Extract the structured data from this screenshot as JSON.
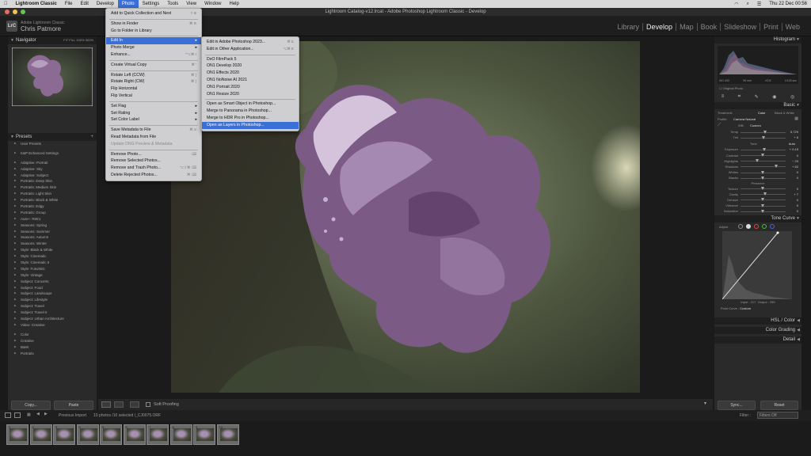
{
  "menubar": {
    "apple": "",
    "app": "Lightroom Classic",
    "items": [
      "File",
      "Edit",
      "Develop",
      "Photo",
      "Settings",
      "Tools",
      "View",
      "Window",
      "Help"
    ],
    "active": "Photo",
    "clock": "Thu 22 Dec  00:56"
  },
  "window": {
    "title": "Lightroom Catalog-v12.lrcat - Adobe Photoshop Lightroom Classic - Develop"
  },
  "identity": {
    "logo": "LrC",
    "line1": "Adobe Lightroom Classic",
    "line2": "Chris Patmore"
  },
  "modules": [
    "Library",
    "Develop",
    "Map",
    "Book",
    "Slideshow",
    "Print",
    "Web"
  ],
  "current_module": "Develop",
  "left_panel": {
    "navigator": "Navigator",
    "nav_zoom": [
      "FIT",
      "FILL",
      "100%",
      "300%"
    ],
    "presets_title": "Presets",
    "preset_groups": [
      "User Presets",
      "",
      "K&P Enhanced Settings",
      "",
      "Adaptive: Portrait",
      "Adaptive: Sky",
      "Adaptive: Subject",
      "Portraits: Deep Skin",
      "Portraits: Medium Skin",
      "Portraits: Light Skin",
      "Portraits: Black & White",
      "Portraits: Edgy",
      "Portraits: Group",
      "Auto+: Retro",
      "Seasons: Spring",
      "Seasons: Summer",
      "Seasons: Autumn",
      "Seasons: Winter",
      "Style: Black & White",
      "Style: Cinematic",
      "Style: Cinematic II",
      "Style: Futuristic",
      "Style: Vintage",
      "Subject: Concerts",
      "Subject: Food",
      "Subject: Landscape",
      "Subject: Lifestyle",
      "Subject: Travel",
      "Subject: Travel II",
      "Subject: Urban Architecture",
      "Video: Creative",
      "",
      "Color",
      "Creative",
      "B&W",
      "Portraits"
    ],
    "copy": "Copy...",
    "paste": "Paste"
  },
  "photo_menu": {
    "items": [
      {
        "label": "Add to Quick Collection and Next",
        "shortcut": "⇧ B"
      },
      {
        "sep": true
      },
      {
        "label": "Show in Finder",
        "shortcut": "⌘ R"
      },
      {
        "label": "Go to Folder in Library",
        "shortcut": ""
      },
      {
        "sep": true
      },
      {
        "label": "Edit In",
        "submenu": true,
        "hl": true
      },
      {
        "label": "Photo Merge",
        "submenu": true
      },
      {
        "label": "Enhance...",
        "shortcut": "^⌥⌘ I"
      },
      {
        "sep": true
      },
      {
        "label": "Create Virtual Copy",
        "shortcut": "⌘ '"
      },
      {
        "sep": true
      },
      {
        "label": "Rotate Left (CCW)",
        "shortcut": "⌘ ["
      },
      {
        "label": "Rotate Right (CW)",
        "shortcut": "⌘ ]"
      },
      {
        "label": "Flip Horizontal",
        "shortcut": ""
      },
      {
        "label": "Flip Vertical",
        "shortcut": ""
      },
      {
        "sep": true
      },
      {
        "label": "Set Flag",
        "submenu": true
      },
      {
        "label": "Set Rating",
        "submenu": true
      },
      {
        "label": "Set Color Label",
        "submenu": true
      },
      {
        "sep": true
      },
      {
        "label": "Save Metadata to File",
        "shortcut": "⌘ S"
      },
      {
        "label": "Read Metadata from File",
        "shortcut": ""
      },
      {
        "label": "Update DNG Preview & Metadata",
        "disabled": true
      },
      {
        "sep": true
      },
      {
        "label": "Remove Photo...",
        "shortcut": "⌫"
      },
      {
        "label": "Remove Selected Photos...",
        "shortcut": ""
      },
      {
        "label": "Remove and Trash Photo...",
        "shortcut": "⌥⇧⌘ ⌫"
      },
      {
        "label": "Delete Rejected Photos...",
        "shortcut": "⌘ ⌫"
      }
    ]
  },
  "editin_menu": {
    "items": [
      {
        "label": "Edit in Adobe Photoshop 2023...",
        "shortcut": "⌘ E"
      },
      {
        "label": "Edit in Other Application...",
        "shortcut": "⌥⌘ E"
      },
      {
        "sep": true
      },
      {
        "label": "DxO FilmPack 5"
      },
      {
        "label": "ON1 Develop 2020"
      },
      {
        "label": "ON1 Effects 2020"
      },
      {
        "label": "ON1 NoNoise AI 2021"
      },
      {
        "label": "ON1 Portrait 2020"
      },
      {
        "label": "ON1 Resize 2020"
      },
      {
        "sep": true
      },
      {
        "label": "Open as Smart Object in Photoshop..."
      },
      {
        "label": "Merge to Panorama in Photoshop..."
      },
      {
        "label": "Merge to HDR Pro in Photoshop..."
      },
      {
        "label": "Open as Layers in Photoshop...",
        "hl": true
      }
    ]
  },
  "right_panel": {
    "histogram": "Histogram",
    "hist_readout": [
      "ISO 400",
      "50 mm",
      "f/2.8",
      "1/125 sec"
    ],
    "original_photo": "Original Photo",
    "basic": "Basic",
    "treatment": "Treatment:",
    "treat_color": "Color",
    "treat_bw": "Black & White",
    "profile_label": "Profile:",
    "profile_value": "Camera Natural",
    "wb_label": "WB:",
    "wb_value": "Custom",
    "sliders_wb": [
      {
        "label": "Temp",
        "value": "5,729",
        "pos": 0.55
      },
      {
        "label": "Tint",
        "value": "+ 6",
        "pos": 0.52
      }
    ],
    "tone_label": "Tone",
    "tone_auto": "Auto",
    "sliders_tone": [
      {
        "label": "Exposure",
        "value": "+ 0.15",
        "pos": 0.53
      },
      {
        "label": "Contrast",
        "value": "0",
        "pos": 0.5
      },
      {
        "label": "Highlights",
        "value": "− 23",
        "pos": 0.38
      },
      {
        "label": "Shadows",
        "value": "+ 62",
        "pos": 0.8
      },
      {
        "label": "Whites",
        "value": "0",
        "pos": 0.5
      },
      {
        "label": "Blacks",
        "value": "0",
        "pos": 0.5
      }
    ],
    "presence_label": "Presence",
    "sliders_presence": [
      {
        "label": "Texture",
        "value": "0",
        "pos": 0.5
      },
      {
        "label": "Clarity",
        "value": "+ 7",
        "pos": 0.55
      },
      {
        "label": "Dehaze",
        "value": "0",
        "pos": 0.5
      },
      {
        "label": "Vibrance",
        "value": "0",
        "pos": 0.5
      },
      {
        "label": "Saturation",
        "value": "0",
        "pos": 0.5
      }
    ],
    "tone_curve": "Tone Curve",
    "adjust": "Adjust",
    "input_label": "Input :",
    "input_value": "217",
    "output_label": "Output :",
    "output_value": "255",
    "point_curve_label": "Point Curve :",
    "point_curve_value": "Custom",
    "hsl": "HSL / Color",
    "color_grading": "Color Grading",
    "detail": "Detail",
    "sync": "Sync...",
    "reset": "Reset"
  },
  "toolbar": {
    "soft_proofing": "Soft Proofing"
  },
  "filmstrip": {
    "source": "Previous Import",
    "count": "10 photos /10 selected /_CJ0075.ORF",
    "filter_label": "Filter :",
    "filter_value": "Filters Off",
    "numbers": [
      "1",
      "2",
      "3",
      "4",
      "5",
      "6",
      "7",
      "8",
      "9",
      "10"
    ]
  },
  "colors": {
    "highlight": "#3a6fd8",
    "menu_bg": "#cfcfd1",
    "panel_bg": "#2a2a2a"
  }
}
